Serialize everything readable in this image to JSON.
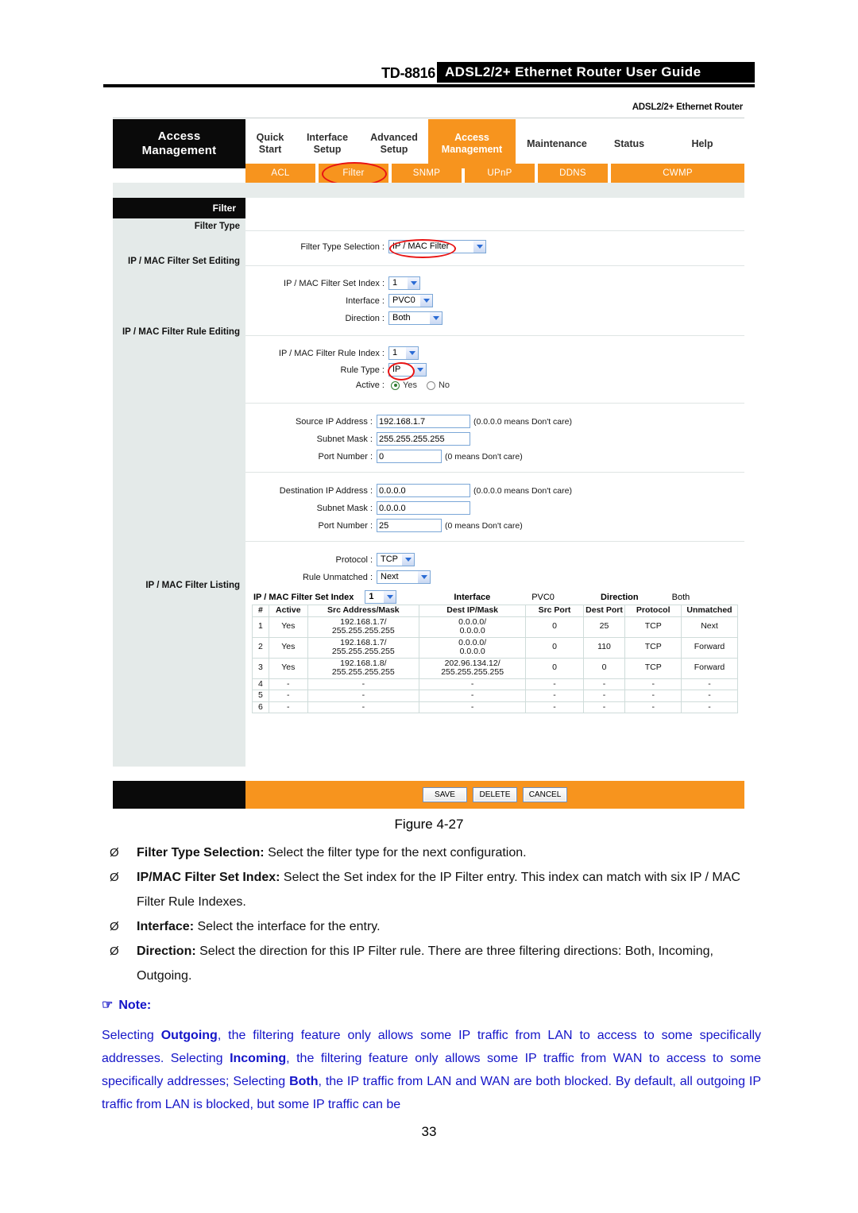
{
  "header": {
    "model": "TD-8816",
    "title": "ADSL2/2+ Ethernet Router User Guide"
  },
  "ui": {
    "brand_line": "ADSL2/2+ Ethernet Router",
    "logo": {
      "line1": "Access",
      "line2": "Management"
    },
    "main_tabs": [
      {
        "line1": "Quick",
        "line2": "Start",
        "selected": false
      },
      {
        "line1": "Interface",
        "line2": "Setup",
        "selected": false
      },
      {
        "line1": "Advanced",
        "line2": "Setup",
        "selected": false
      },
      {
        "line1": "Access",
        "line2": "Management",
        "selected": true
      },
      {
        "line1": "Maintenance",
        "line2": "",
        "selected": false
      },
      {
        "line1": "Status",
        "line2": "",
        "selected": false
      },
      {
        "line1": "Help",
        "line2": "",
        "selected": false
      }
    ],
    "sub_tabs": [
      "ACL",
      "Filter",
      "SNMP",
      "UPnP",
      "DDNS",
      "CWMP"
    ],
    "sub_tab_selected": "Filter",
    "section_title": "Filter",
    "left_labels": {
      "filter_type": "Filter Type",
      "set_editing": "IP / MAC Filter Set Editing",
      "rule_editing": "IP / MAC Filter Rule Editing",
      "listing": "IP / MAC Filter Listing"
    },
    "form": {
      "filter_type_selection_label": "Filter Type Selection :",
      "filter_type_selection_value": "IP / MAC Filter",
      "set_index_label": "IP / MAC Filter Set Index :",
      "set_index_value": "1",
      "interface_label": "Interface :",
      "interface_value": "PVC0",
      "direction_label": "Direction :",
      "direction_value": "Both",
      "rule_index_label": "IP / MAC Filter Rule Index :",
      "rule_index_value": "1",
      "rule_type_label": "Rule Type :",
      "rule_type_value": "IP",
      "active_label": "Active :",
      "active_yes": "Yes",
      "active_no": "No",
      "active_selected": "Yes",
      "source_ip_label": "Source IP Address :",
      "source_ip_value": "192.168.1.7",
      "source_mask_label": "Subnet Mask :",
      "source_mask_value": "255.255.255.255",
      "source_port_label": "Port Number :",
      "source_port_value": "0",
      "dest_ip_label": "Destination IP Address :",
      "dest_ip_value": "0.0.0.0",
      "dest_mask_label": "Subnet Mask :",
      "dest_mask_value": "0.0.0.0",
      "dest_port_label": "Port Number :",
      "dest_port_value": "25",
      "protocol_label": "Protocol :",
      "protocol_value": "TCP",
      "rule_unmatched_label": "Rule Unmatched :",
      "rule_unmatched_value": "Next",
      "hint_ip": "(0.0.0.0 means Don't care)",
      "hint_port": "(0 means Don't care)"
    },
    "listing": {
      "set_index_label": "IP / MAC Filter Set Index",
      "set_index_value": "1",
      "interface_label": "Interface",
      "interface_value": "PVC0",
      "direction_label": "Direction",
      "direction_value": "Both",
      "columns": [
        "#",
        "Active",
        "Src Address/Mask",
        "Dest IP/Mask",
        "Src Port",
        "Dest Port",
        "Protocol",
        "Unmatched"
      ],
      "rows": [
        {
          "num": "1",
          "active": "Yes",
          "src1": "192.168.1.7/",
          "src2": "255.255.255.255",
          "dst1": "0.0.0.0/",
          "dst2": "0.0.0.0",
          "sport": "0",
          "dport": "25",
          "proto": "TCP",
          "unmatched": "Next"
        },
        {
          "num": "2",
          "active": "Yes",
          "src1": "192.168.1.7/",
          "src2": "255.255.255.255",
          "dst1": "0.0.0.0/",
          "dst2": "0.0.0.0",
          "sport": "0",
          "dport": "110",
          "proto": "TCP",
          "unmatched": "Forward"
        },
        {
          "num": "3",
          "active": "Yes",
          "src1": "192.168.1.8/",
          "src2": "255.255.255.255",
          "dst1": "202.96.134.12/",
          "dst2": "255.255.255.255",
          "sport": "0",
          "dport": "0",
          "proto": "TCP",
          "unmatched": "Forward"
        },
        {
          "num": "4",
          "active": "-",
          "src1": "-",
          "src2": "",
          "dst1": "-",
          "dst2": "",
          "sport": "-",
          "dport": "-",
          "proto": "-",
          "unmatched": "-"
        },
        {
          "num": "5",
          "active": "-",
          "src1": "-",
          "src2": "",
          "dst1": "-",
          "dst2": "",
          "sport": "-",
          "dport": "-",
          "proto": "-",
          "unmatched": "-"
        },
        {
          "num": "6",
          "active": "-",
          "src1": "-",
          "src2": "",
          "dst1": "-",
          "dst2": "",
          "sport": "-",
          "dport": "-",
          "proto": "-",
          "unmatched": "-"
        }
      ]
    },
    "buttons": {
      "save": "SAVE",
      "delete": "DELETE",
      "cancel": "CANCEL"
    },
    "accent_color": "#F7941E"
  },
  "figure_caption": "Figure 4-27",
  "bullets": [
    {
      "arrow": "Ø",
      "term": "Filter Type Selection:",
      "text": " Select the filter type for the next configuration."
    },
    {
      "arrow": "Ø",
      "term": "IP/MAC Filter Set Index:",
      "text": " Select the Set index for the IP Filter entry. This index can match with six IP / MAC Filter Rule Indexes."
    },
    {
      "arrow": "Ø",
      "term": "Interface:",
      "text": " Select the interface for the entry."
    },
    {
      "arrow": "Ø",
      "term": "Direction:",
      "text": " Select the direction for this IP Filter rule. There are three filtering directions: Both, Incoming, Outgoing."
    }
  ],
  "note": {
    "hand_icon": "☞",
    "heading": "Note:",
    "color": "#1414c8",
    "parts": [
      {
        "t": "Selecting ",
        "b": false
      },
      {
        "t": "Outgoing",
        "b": true
      },
      {
        "t": ", the filtering feature only allows some IP traffic from LAN to access to some specifically addresses. Selecting ",
        "b": false
      },
      {
        "t": "Incoming",
        "b": true
      },
      {
        "t": ", the filtering feature only allows some IP traffic from WAN to access to some specifically addresses; Selecting ",
        "b": false
      },
      {
        "t": "Both",
        "b": true
      },
      {
        "t": ", the IP traffic from LAN and WAN are both blocked. By default, all outgoing IP traffic from LAN is blocked, but some IP traffic can be",
        "b": false
      }
    ]
  },
  "page_number": "33"
}
